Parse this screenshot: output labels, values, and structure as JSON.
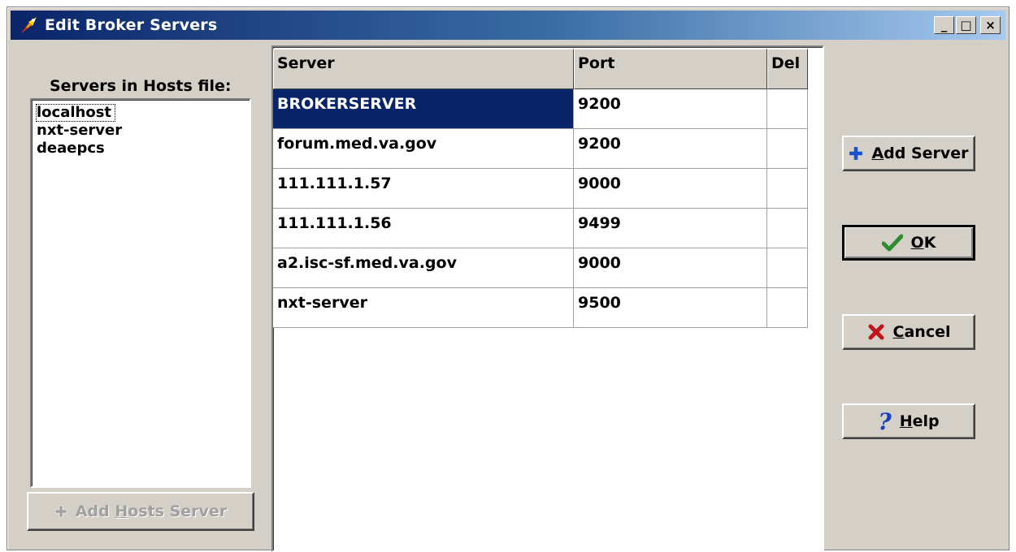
{
  "window": {
    "title": "Edit Broker Servers",
    "controls": {
      "minimize": "_",
      "maximize": "□",
      "close": "×"
    }
  },
  "hosts_panel": {
    "label": "Servers in Hosts file:",
    "items": [
      "localhost",
      "nxt-server",
      "deaepcs"
    ],
    "add_hosts_button": {
      "prefix": "Add ",
      "mnemonic": "H",
      "suffix": "osts Server"
    }
  },
  "grid": {
    "columns": [
      "Server",
      "Port",
      "Del"
    ],
    "rows": [
      {
        "server": "BROKERSERVER",
        "port": "9200",
        "del": ""
      },
      {
        "server": "forum.med.va.gov",
        "port": "9200",
        "del": ""
      },
      {
        "server": "111.111.1.57",
        "port": "9000",
        "del": ""
      },
      {
        "server": "111.111.1.56",
        "port": "9499",
        "del": ""
      },
      {
        "server": "a2.isc-sf.med.va.gov",
        "port": "9000",
        "del": ""
      },
      {
        "server": "nxt-server",
        "port": "9500",
        "del": ""
      }
    ]
  },
  "buttons": {
    "add_server": {
      "mnemonic": "A",
      "rest": "dd Server"
    },
    "ok": {
      "mnemonic": "O",
      "rest": "K"
    },
    "cancel": {
      "mnemonic": "C",
      "rest": "ancel"
    },
    "help": {
      "mnemonic": "H",
      "rest": "elp"
    }
  },
  "colors": {
    "title_start": "#0a246a",
    "selection": "#0a246a",
    "face": "#d4d0c8"
  }
}
